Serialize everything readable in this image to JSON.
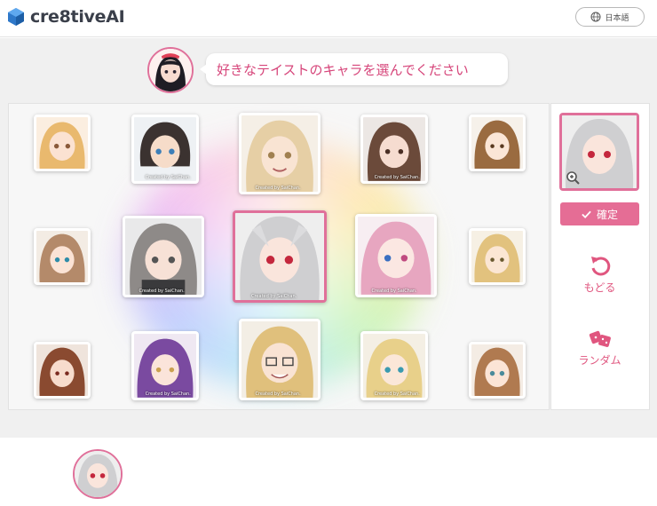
{
  "header": {
    "logo_text": "cre8tiveAI",
    "language_label": "日本語"
  },
  "prompt": {
    "message": "好きなテイストのキャラを選んでください"
  },
  "grid": {
    "credit_text": "Created by SaiChan."
  },
  "side": {
    "confirm_label": "確定",
    "undo_label": "もどる",
    "random_label": "ランダム"
  },
  "colors": {
    "accent": "#e56d95",
    "accent_text": "#d6457a",
    "logo_blue": "#2e78c9"
  },
  "icons": [
    "globe-icon",
    "zoom-icon",
    "check-icon",
    "undo-icon",
    "dice-icon"
  ]
}
